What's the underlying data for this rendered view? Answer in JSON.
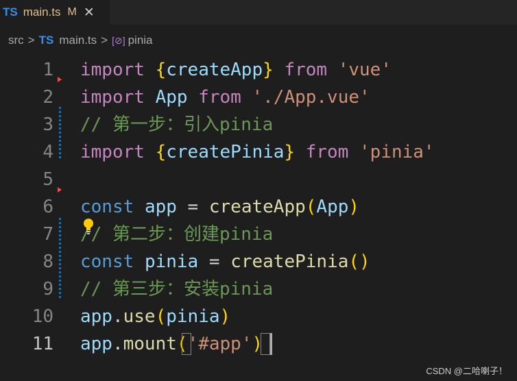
{
  "tab": {
    "lang_badge": "TS",
    "title": "main.ts",
    "modified": "M",
    "close": "✕"
  },
  "breadcrumb": {
    "folder": "src",
    "sep": ">",
    "lang_badge": "TS",
    "file": "main.ts",
    "symbol_icon": "[⊘]",
    "symbol": "pinia"
  },
  "editor": {
    "lines": [
      {
        "num": "1",
        "tokens": [
          "import",
          " ",
          "{",
          "createApp",
          "}",
          " ",
          "from",
          " ",
          "'vue'"
        ]
      },
      {
        "num": "2",
        "tokens": [
          "import",
          " ",
          "App",
          " ",
          "from",
          " ",
          "'./App.vue'"
        ]
      },
      {
        "num": "3",
        "tokens": [
          "// 第一步：引入pinia"
        ]
      },
      {
        "num": "4",
        "tokens": [
          "import",
          " ",
          "{",
          "createPinia",
          "}",
          " ",
          "from",
          " ",
          "'pinia'"
        ]
      },
      {
        "num": "5",
        "tokens": [
          ""
        ]
      },
      {
        "num": "6",
        "tokens": [
          "const",
          " ",
          "app",
          " = ",
          "createApp",
          "(",
          "App",
          ")"
        ]
      },
      {
        "num": "7",
        "tokens": [
          "// 第二步：创建pinia"
        ]
      },
      {
        "num": "8",
        "tokens": [
          "const",
          " ",
          "pinia",
          " = ",
          "createPinia",
          "()"
        ]
      },
      {
        "num": "9",
        "tokens": [
          "// 第三步：安装pinia"
        ]
      },
      {
        "num": "10",
        "tokens": [
          "app",
          ".",
          "use",
          "(",
          "pinia",
          ")"
        ]
      },
      {
        "num": "11",
        "tokens": [
          "app",
          ".",
          "mount",
          "(",
          "'#app'",
          ")"
        ]
      }
    ]
  },
  "icons": {
    "bulb": "lightbulb-icon",
    "fold": "fold-arrow-icon"
  },
  "colors": {
    "keyword": "#c586c0",
    "declaration": "#569cd6",
    "variable": "#9cdcfe",
    "function": "#dcdcaa",
    "string": "#ce9178",
    "comment": "#6a9955",
    "bracket": "#ffd700",
    "ts_badge": "#3b8eea",
    "tab_modified": "#e2c08d"
  },
  "watermark": "CSDN @二哈喇子！"
}
